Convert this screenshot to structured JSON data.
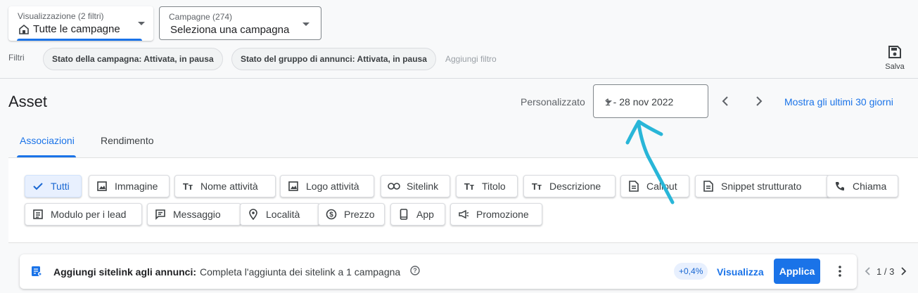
{
  "view_selector": {
    "label": "Visualizzazione (2 filtri)",
    "value": "Tutte le campagne"
  },
  "campaign_selector": {
    "label": "Campagne (274)",
    "value": "Seleziona una campagna"
  },
  "filters": {
    "label": "Filtri",
    "chips": [
      "Stato della campagna: Attivata, in pausa",
      "Stato del gruppo di annunci: Attivata, in pausa"
    ],
    "add_label": "Aggiungi filtro"
  },
  "save_label": "Salva",
  "page_title": "Asset",
  "date": {
    "period_label": "Personalizzato",
    "range": "1 - 28 nov 2022",
    "last30_label": "Mostra gli ultimi 30 giorni"
  },
  "tabs": [
    {
      "label": "Associazioni",
      "active": true
    },
    {
      "label": "Rendimento",
      "active": false
    }
  ],
  "asset_types": [
    {
      "label": "Tutti",
      "icon": "check-icon",
      "selected": true
    },
    {
      "label": "Immagine",
      "icon": "image-icon"
    },
    {
      "label": "Nome attività",
      "icon": "text-icon"
    },
    {
      "label": "Logo attività",
      "icon": "image-icon"
    },
    {
      "label": "Sitelink",
      "icon": "link-icon"
    },
    {
      "label": "Titolo",
      "icon": "text-icon"
    },
    {
      "label": "Descrizione",
      "icon": "text-icon"
    },
    {
      "label": "Callout",
      "icon": "document-icon"
    },
    {
      "label": "Snippet strutturato",
      "icon": "document-icon"
    },
    {
      "label": "Chiama",
      "icon": "phone-icon"
    },
    {
      "label": "Modulo per i lead",
      "icon": "form-icon"
    },
    {
      "label": "Messaggio",
      "icon": "message-icon"
    },
    {
      "label": "Località",
      "icon": "location-icon"
    },
    {
      "label": "Prezzo",
      "icon": "price-icon"
    },
    {
      "label": "App",
      "icon": "mobile-icon"
    },
    {
      "label": "Promozione",
      "icon": "megaphone-icon"
    }
  ],
  "recommendation": {
    "title": "Aggiungi sitelink agli annunci:",
    "description": "Completa l'aggiunta dei sitelink a 1 campagna",
    "uplift": "+0,4%",
    "view_label": "Visualizza",
    "apply_label": "Applica",
    "pager": "1 / 3"
  },
  "colors": {
    "accent": "#1a73e8",
    "annotation": "#29b6d8"
  }
}
